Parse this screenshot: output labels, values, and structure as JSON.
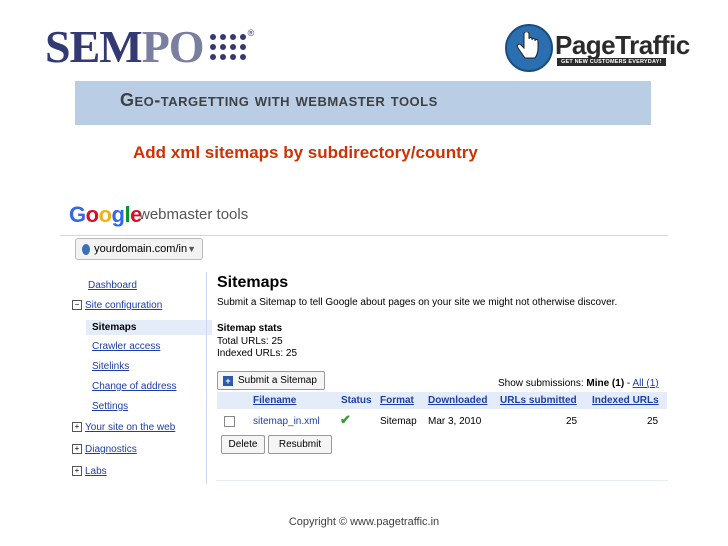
{
  "slide": {
    "logo_left": "SEMPO",
    "logo_left_reg": "®",
    "logo_right": "PageTraffic",
    "logo_right_tagline": "GET NEW CUSTOMERS EVERYDAY!",
    "title": "Geo-targetting with webmaster tools",
    "subtitle": "Add xml sitemaps by subdirectory/country",
    "copyright": "Copyright © www.pagetraffic.in",
    "colors": {
      "title_bar": "#b9cde5",
      "subtitle": "#cc3300",
      "sempo_blue": "#333a73"
    }
  },
  "gwt": {
    "logo_google": [
      "G",
      "o",
      "o",
      "g",
      "l",
      "e"
    ],
    "logo_product": "webmaster tools",
    "domain_select": "yourdomain.com/in",
    "sidebar": [
      {
        "label": "Dashboard",
        "prefix": ""
      },
      {
        "label": "Site configuration",
        "prefix": "−"
      },
      {
        "label": "Sitemaps",
        "prefix": ""
      },
      {
        "label": "Crawler access",
        "prefix": ""
      },
      {
        "label": "Sitelinks",
        "prefix": ""
      },
      {
        "label": "Change of address",
        "prefix": ""
      },
      {
        "label": "Settings",
        "prefix": ""
      },
      {
        "label": "Your site on the web",
        "prefix": "+"
      },
      {
        "label": "Diagnostics",
        "prefix": "+"
      },
      {
        "label": "Labs",
        "prefix": "+"
      }
    ],
    "main": {
      "title": "Sitemaps",
      "description": "Submit a Sitemap to tell Google about pages on your site we might not otherwise discover.",
      "stats_heading": "Sitemap stats",
      "total_urls": "Total URLs: 25",
      "indexed_urls": "Indexed URLs: 25",
      "submit_button": "Submit a Sitemap",
      "show_submissions_label": "Show submissions:",
      "show_mine": "Mine (1)",
      "show_sep": " - ",
      "show_all": "All (1)",
      "columns": [
        "Filename",
        "Status",
        "Format",
        "Downloaded",
        "URLs submitted",
        "Indexed URLs"
      ],
      "rows": [
        {
          "filename": "sitemap_in.xml",
          "status": "✔",
          "format": "Sitemap",
          "downloaded": "Mar 3, 2010",
          "urls_submitted": "25",
          "indexed_urls": "25"
        }
      ],
      "delete_button": "Delete",
      "resubmit_button": "Resubmit"
    }
  }
}
